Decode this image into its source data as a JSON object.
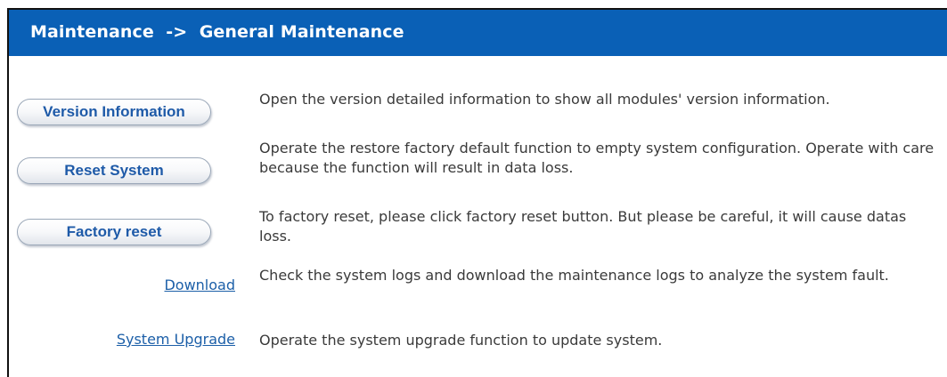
{
  "header": {
    "title": "Maintenance  ->  General Maintenance"
  },
  "items": [
    {
      "label": "Version Information",
      "kind": "button",
      "description": "Open the version detailed information to show all modules' version information."
    },
    {
      "label": "Reset System",
      "kind": "button",
      "description": "Operate the restore factory default function to empty system configuration. Operate with care because the function will result in data loss."
    },
    {
      "label": "Factory reset",
      "kind": "button",
      "description": "To factory reset, please click factory reset button. But please be careful, it will cause datas loss."
    },
    {
      "label": "Download",
      "kind": "link",
      "description": "Check the system logs and download the maintenance logs to analyze the system fault."
    },
    {
      "label": "System Upgrade",
      "kind": "link",
      "description": "Operate the system upgrade function to update system."
    }
  ],
  "colors": {
    "header_bg": "#0a60b6",
    "header_text": "#ffffff",
    "button_text": "#1e5aa8",
    "link_text": "#1c5fa8",
    "description_text": "#3a3a3a"
  }
}
